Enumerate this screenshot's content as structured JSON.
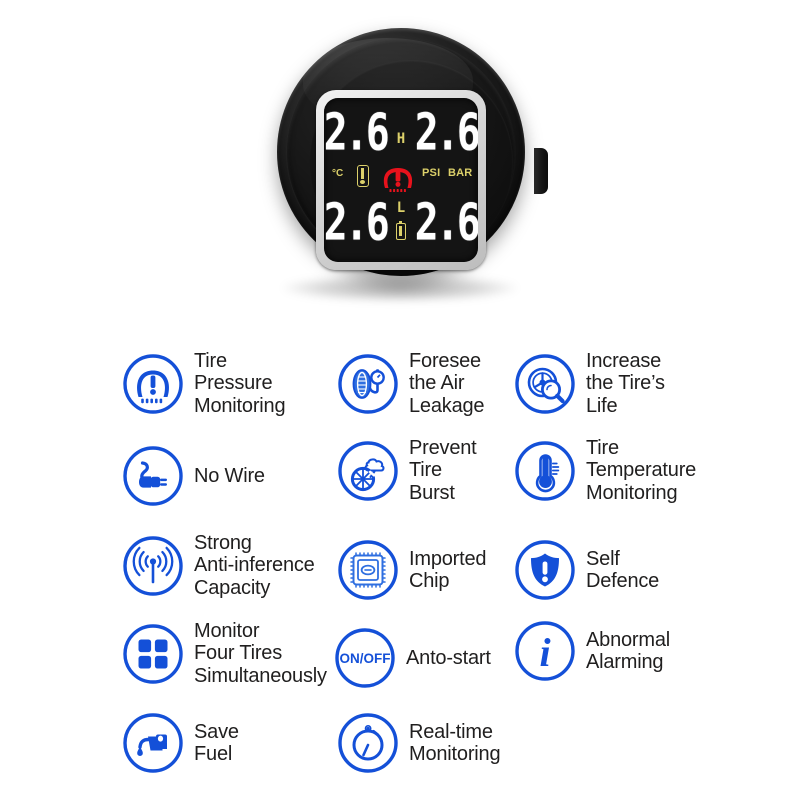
{
  "watermark": "",
  "colors": {
    "brand_blue": "#1450d8",
    "icon_blue_light": "#2f6fe0",
    "lcd_yellow": "#dcd06a",
    "lcd_red": "#e8121c",
    "lcd_white": "#ffffff",
    "lcd_background": "#141414",
    "device_black": "#111111",
    "text_black": "#201f1f",
    "page_background": "#ffffff"
  },
  "device": {
    "name": "tpms-display-unit",
    "side_button": "power-button",
    "lcd": {
      "top_left_value": "2.6",
      "top_right_value": "2.6",
      "bottom_left_value": "2.6",
      "bottom_right_value": "2.6",
      "high_marker": "H",
      "low_marker": "L",
      "unit_celsius": "°C",
      "unit_psi": "PSI",
      "unit_bar": "BAR",
      "thermometer_icon": "thermometer-icon",
      "battery_icon": "battery-icon",
      "warning_icon": "tpms-warning-icon"
    }
  },
  "features": [
    {
      "icon": "tire-pressure-warning-icon",
      "label": "Tire\nPressure\nMonitoring"
    },
    {
      "icon": "tire-gauge-icon",
      "label": "Foresee\nthe Air\nLeakage"
    },
    {
      "icon": "wheel-magnifier-icon",
      "label": "Increase\nthe Tire’s\nLife"
    },
    {
      "icon": "unplugged-plug-icon",
      "label": "No Wire"
    },
    {
      "icon": "tire-burst-icon",
      "label": "Prevent\nTire\nBurst"
    },
    {
      "icon": "thermometer-icon",
      "label": "Tire\nTemperature\nMonitoring"
    },
    {
      "icon": "signal-waves-icon",
      "label": "Strong\nAnti-inference\nCapacity"
    },
    {
      "icon": "chip-icon",
      "label": "Imported\nChip"
    },
    {
      "icon": "shield-exclamation-icon",
      "label": "Self\nDefence"
    },
    {
      "icon": "four-squares-icon",
      "label": "Monitor\nFour Tires\nSimultaneously"
    },
    {
      "icon": "on-off-icon",
      "label": "Anto-start",
      "icon_text": "ON/OFF"
    },
    {
      "icon": "info-icon",
      "label": "Abnormal\nAlarming",
      "icon_text": "i"
    },
    {
      "icon": "fuel-nozzle-icon",
      "label": "Save\nFuel"
    },
    {
      "icon": "stopwatch-icon",
      "label": "Real-time\nMonitoring"
    }
  ]
}
